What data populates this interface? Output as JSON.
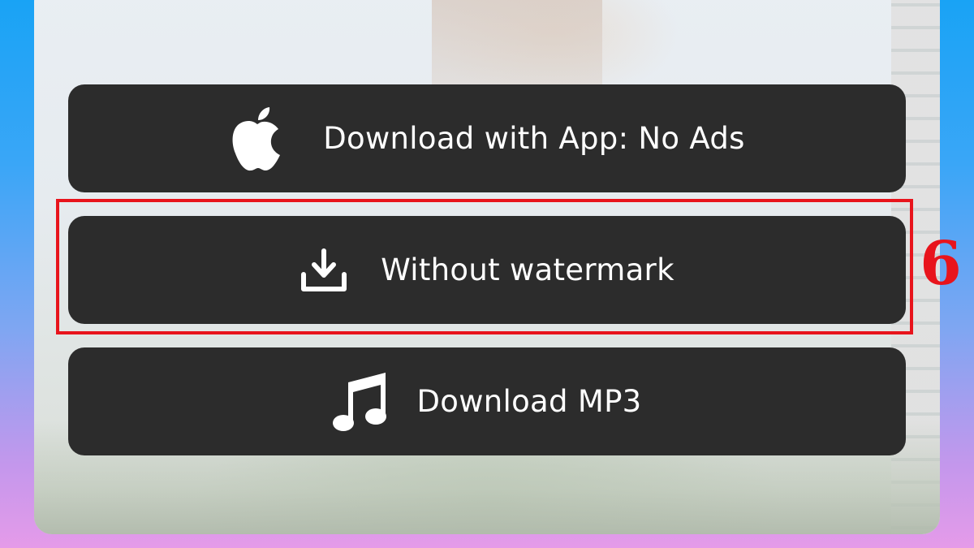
{
  "buttons": {
    "app": {
      "label": "Download with App: No Ads",
      "icon": "apple-icon"
    },
    "no_watermark": {
      "label": "Without watermark",
      "icon": "download-icon"
    },
    "mp3": {
      "label": "Download MP3",
      "icon": "music-note-icon"
    }
  },
  "annotation": {
    "step_number": "6",
    "color": "#e8141c"
  },
  "colors": {
    "button_bg": "#2c2c2c",
    "button_text": "#ffffff"
  }
}
